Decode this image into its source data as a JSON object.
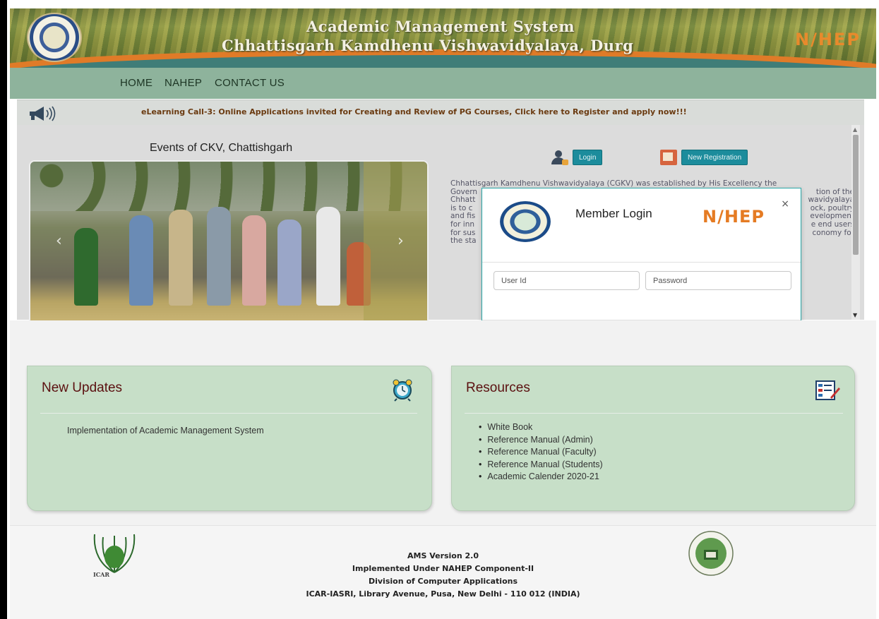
{
  "header": {
    "app_title": "Academic Management System",
    "university": "Chhattisgarh Kamdhenu Vishwavidyalaya, Durg",
    "nahep_logo": "N/HEP",
    "logo_icon": "university-seal-logo"
  },
  "nav": {
    "items": [
      "HOME",
      "NAHEP",
      "CONTACT US"
    ]
  },
  "ticker": {
    "icon": "megaphone-icon",
    "text": "eLearning Call-3: Online Applications invited for Creating and Review of PG Courses, Click here to Register and apply now!!!"
  },
  "main": {
    "events_title": "Events of CKV, Chattishgarh",
    "carousel": {
      "prev": "‹",
      "next": "›"
    },
    "login_label": "Login",
    "new_registration_label": "New Registration",
    "about_lines": [
      "Chhattisgarh Kamdhenu Vishwavidyalaya (CGKV) was established by His Excellency the",
      "Govern",
      "Chhatt",
      "is to c",
      "and fis",
      "for inn",
      "for sus",
      "the sta"
    ],
    "about_right": [
      "tion of the",
      "wavidyalaya",
      "ock, poultry",
      "evelopment",
      "e end users",
      "conomy for"
    ]
  },
  "modal": {
    "title": "Member Login",
    "nahep_logo": "N/HEP",
    "close": "×",
    "userid_placeholder": "User Id",
    "password_placeholder": "Password"
  },
  "updates": {
    "title": "New Updates",
    "icon": "alarm-clock-icon",
    "items": [
      "Implementation of Academic Management System"
    ]
  },
  "resources": {
    "title": "Resources",
    "icon": "document-edit-icon",
    "items": [
      "White Book",
      "Reference Manual (Admin)",
      "Reference Manual (Faculty)",
      "Reference Manual (Students)",
      "Academic Calender 2020-21"
    ]
  },
  "footer": {
    "icar_label": "ICAR",
    "lines": [
      "AMS Version 2.0",
      "Implemented Under NAHEP Component-II",
      "Division of Computer Applications",
      "ICAR-IASRI, Library Avenue, Pusa, New Delhi - 110 012 (INDIA)"
    ]
  },
  "colors": {
    "nav_bg": "#8eb39c",
    "card_bg": "#c7dfc8",
    "card_title": "#5b1010",
    "ticker_text": "#6a3a10",
    "button_teal": "#1c8c9c",
    "nahep_orange": "#e57b23"
  }
}
